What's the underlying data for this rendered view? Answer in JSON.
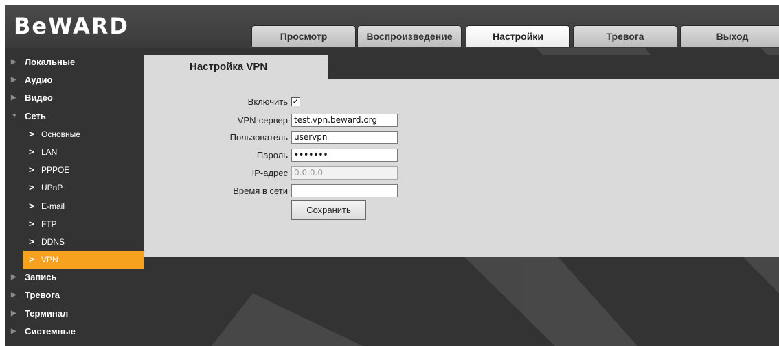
{
  "app": {
    "logo": "BeWARD"
  },
  "nav": {
    "tabs": [
      {
        "label": "Просмотр",
        "active": false
      },
      {
        "label": "Воспроизведение",
        "active": false
      },
      {
        "label": "Настройки",
        "active": true
      },
      {
        "label": "Тревога",
        "active": false
      },
      {
        "label": "Выход",
        "active": false
      }
    ]
  },
  "sidebar": {
    "items": [
      {
        "label": "Локальные"
      },
      {
        "label": "Аудио"
      },
      {
        "label": "Видео"
      },
      {
        "label": "Сеть",
        "expanded": true
      },
      {
        "label": "Основные"
      },
      {
        "label": "LAN"
      },
      {
        "label": "PPPOE"
      },
      {
        "label": "UPnP"
      },
      {
        "label": "E-mail"
      },
      {
        "label": "FTP"
      },
      {
        "label": "DDNS"
      },
      {
        "label": "VPN",
        "active": true
      },
      {
        "label": "Запись"
      },
      {
        "label": "Тревога"
      },
      {
        "label": "Терминал"
      },
      {
        "label": "Системные"
      }
    ]
  },
  "content": {
    "title": "Настройка VPN",
    "form": {
      "enable_label": "Включить",
      "enable_checked": true,
      "server_label": "VPN-сервер",
      "server_value": "test.vpn.beward.org",
      "user_label": "Пользователь",
      "user_value": "uservpn",
      "password_label": "Пароль",
      "password_value": "•••••••",
      "ip_label": "IP-адрес",
      "ip_value": "0.0.0.0",
      "uptime_label": "Время в сети",
      "uptime_value": "",
      "save_label": "Сохранить"
    }
  },
  "colors": {
    "accent": "#f6a21e",
    "background": "#333333",
    "panel": "#dadada"
  }
}
